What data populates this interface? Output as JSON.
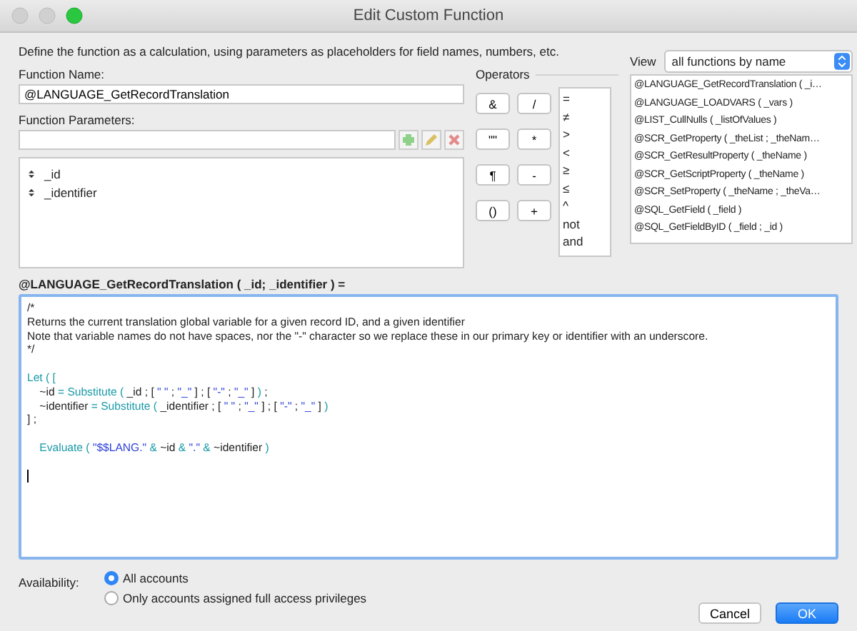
{
  "window": {
    "title": "Edit Custom Function"
  },
  "description": "Define the function as a calculation, using parameters as placeholders for field names, numbers, etc.",
  "function_name": {
    "label": "Function Name:",
    "value": "@LANGUAGE_GetRecordTranslation"
  },
  "function_parameters": {
    "label": "Function Parameters:",
    "items": [
      "_id",
      "_identifier"
    ]
  },
  "operators": {
    "label": "Operators",
    "buttons": [
      "&",
      "/",
      "\"\"",
      "*",
      "¶",
      "-",
      "()",
      "+"
    ],
    "comparisons": [
      "=",
      "≠",
      ">",
      "<",
      "≥",
      "≤",
      "^",
      "not",
      "and"
    ]
  },
  "view": {
    "label": "View",
    "value": "all functions by name"
  },
  "functions": [
    "@LANGUAGE_GetRecordTranslation ( _i…",
    "@LANGUAGE_LOADVARS ( _vars )",
    "@LIST_CullNulls ( _listOfValues )",
    "@SCR_GetProperty ( _theList ; _theNam…",
    "@SCR_GetResultProperty ( _theName )",
    "@SCR_GetScriptProperty ( _theName )",
    "@SCR_SetProperty ( _theName ; _theVa…",
    "@SQL_GetField ( _field )",
    "@SQL_GetFieldByID ( _field ; _id )"
  ],
  "formula_header": "@LANGUAGE_GetRecordTranslation ( _id; _identifier ) =",
  "code_blocks": [
    [
      [
        {
          "kind": "plain",
          "text": "/*"
        }
      ],
      [
        {
          "kind": "plain",
          "text": "Returns the current translation global variable for a given record ID, and a given identifier"
        }
      ],
      [
        {
          "kind": "plain",
          "text": "Note that variable names do not have spaces, nor the \"-\" character so we replace these in our primary key or identifier with an underscore."
        }
      ],
      [
        {
          "kind": "plain",
          "text": "*/"
        }
      ]
    ],
    [
      [
        {
          "kind": "function",
          "text": "Let ( ["
        }
      ],
      [
        {
          "kind": "plain",
          "text": "\t~id "
        },
        {
          "kind": "function",
          "text": "= Substitute ("
        },
        {
          "kind": "plain",
          "text": " _id ; [ "
        },
        {
          "kind": "string",
          "text": "\" \""
        },
        {
          "kind": "plain",
          "text": " ; "
        },
        {
          "kind": "string",
          "text": "\"_\""
        },
        {
          "kind": "plain",
          "text": " ] ; [ "
        },
        {
          "kind": "string",
          "text": "\"-\""
        },
        {
          "kind": "plain",
          "text": " ; "
        },
        {
          "kind": "string",
          "text": "\"_\""
        },
        {
          "kind": "plain",
          "text": " ] "
        },
        {
          "kind": "function",
          "text": ")"
        },
        {
          "kind": "plain",
          "text": " ;"
        }
      ],
      [
        {
          "kind": "plain",
          "text": "\t~identifier "
        },
        {
          "kind": "function",
          "text": "= Substitute ("
        },
        {
          "kind": "plain",
          "text": " _identifier ; [ "
        },
        {
          "kind": "string",
          "text": "\" \""
        },
        {
          "kind": "plain",
          "text": " ; "
        },
        {
          "kind": "string",
          "text": "\"_\""
        },
        {
          "kind": "plain",
          "text": " ] ; [ "
        },
        {
          "kind": "string",
          "text": "\"-\""
        },
        {
          "kind": "plain",
          "text": " ; "
        },
        {
          "kind": "string",
          "text": "\"_\""
        },
        {
          "kind": "plain",
          "text": " ] "
        },
        {
          "kind": "function",
          "text": ")"
        }
      ],
      [
        {
          "kind": "plain",
          "text": "] ;"
        }
      ]
    ],
    [
      [
        {
          "kind": "function",
          "text": "\tEvaluate ( "
        },
        {
          "kind": "string",
          "text": "\"$$LANG.\""
        },
        {
          "kind": "function",
          "text": " & "
        },
        {
          "kind": "plain",
          "text": "~id "
        },
        {
          "kind": "function",
          "text": "& "
        },
        {
          "kind": "string",
          "text": "\".\""
        },
        {
          "kind": "function",
          "text": " & "
        },
        {
          "kind": "plain",
          "text": "~identifier "
        },
        {
          "kind": "function",
          "text": ")"
        }
      ]
    ]
  ],
  "availability": {
    "label": "Availability:",
    "options": [
      {
        "label": "All accounts",
        "selected": true
      },
      {
        "label": "Only accounts assigned full access privileges",
        "selected": false
      }
    ]
  },
  "buttons": [
    {
      "label": "Cancel",
      "kind": "secondary"
    },
    {
      "label": "OK",
      "kind": "primary"
    }
  ]
}
